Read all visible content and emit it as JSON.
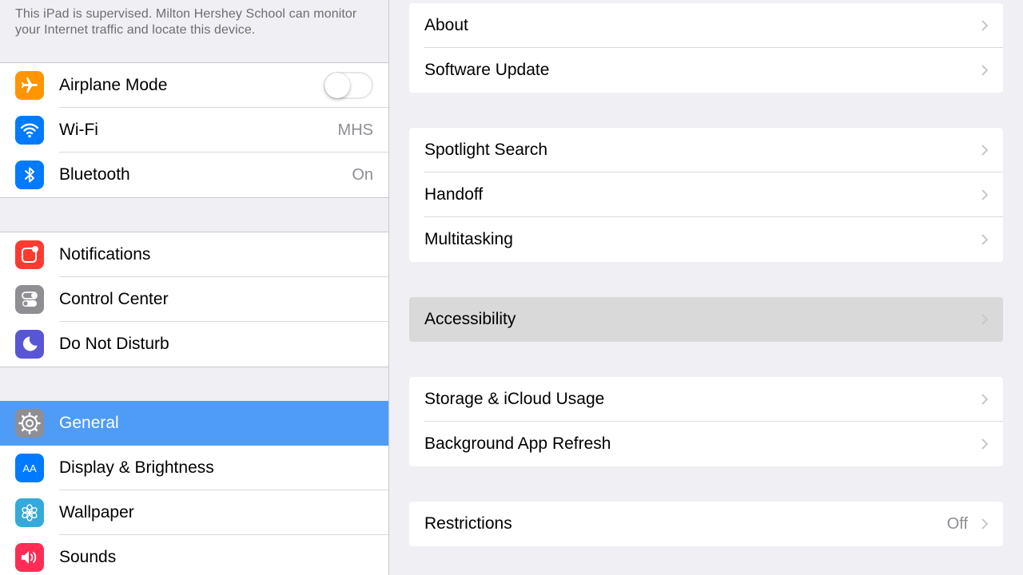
{
  "sidebar": {
    "supervision_note": "This iPad is supervised. Milton Hershey School can monitor your Internet traffic and locate this device.",
    "groups": [
      {
        "items": [
          {
            "label": "Airplane Mode",
            "icon": "airplane-icon",
            "color": "#ff9500",
            "toggle_on": false
          },
          {
            "label": "Wi-Fi",
            "icon": "wifi-icon",
            "color": "#007aff",
            "value": "MHS"
          },
          {
            "label": "Bluetooth",
            "icon": "bluetooth-icon",
            "color": "#007aff",
            "value": "On"
          }
        ]
      },
      {
        "items": [
          {
            "label": "Notifications",
            "icon": "notifications-icon",
            "color": "#ff3b30"
          },
          {
            "label": "Control Center",
            "icon": "control-center-icon",
            "color": "#8e8e93"
          },
          {
            "label": "Do Not Disturb",
            "icon": "moon-icon",
            "color": "#5856d6"
          }
        ]
      },
      {
        "items": [
          {
            "label": "General",
            "icon": "gear-icon",
            "color": "#8e8e93",
            "selected": true
          },
          {
            "label": "Display & Brightness",
            "icon": "display-icon",
            "color": "#007aff",
            "icon_text": "AA"
          },
          {
            "label": "Wallpaper",
            "icon": "wallpaper-icon",
            "color": "#34aadc"
          },
          {
            "label": "Sounds",
            "icon": "speaker-icon",
            "color": "#ff2d55"
          }
        ]
      }
    ]
  },
  "general": {
    "groups": [
      {
        "items": [
          {
            "label": "About"
          },
          {
            "label": "Software Update"
          }
        ]
      },
      {
        "items": [
          {
            "label": "Spotlight Search"
          },
          {
            "label": "Handoff"
          },
          {
            "label": "Multitasking"
          }
        ]
      },
      {
        "items": [
          {
            "label": "Accessibility",
            "highlighted": true
          }
        ]
      },
      {
        "items": [
          {
            "label": "Storage & iCloud Usage"
          },
          {
            "label": "Background App Refresh"
          }
        ]
      },
      {
        "items": [
          {
            "label": "Restrictions",
            "value": "Off"
          }
        ]
      }
    ]
  },
  "colors": {
    "selection": "#4f9cf7",
    "background": "#efeff4",
    "secondary_text": "#8e8e93"
  }
}
